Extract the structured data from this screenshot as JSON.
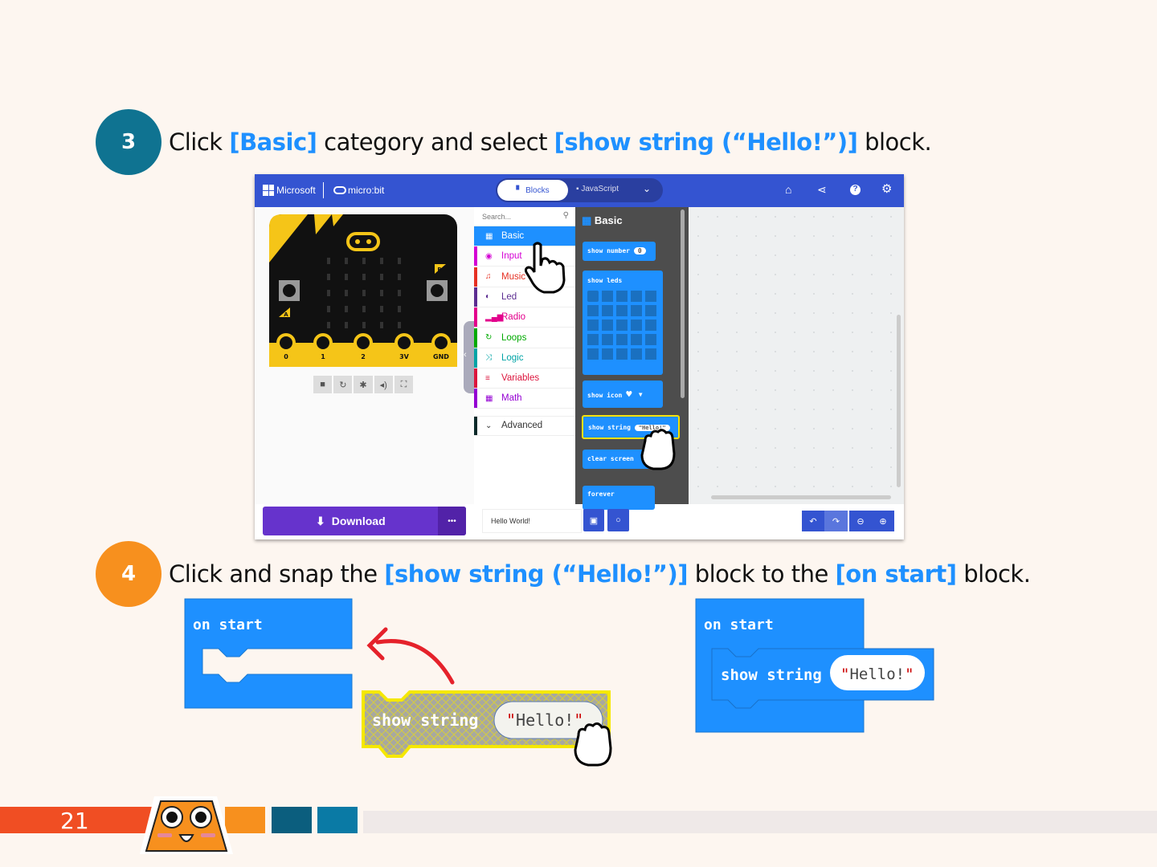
{
  "step3": {
    "number": "3",
    "text_parts": [
      "Click ",
      "[Basic]",
      " category and select ",
      "[show string (“Hello!”)]",
      " block."
    ]
  },
  "editor": {
    "brand": "Microsoft",
    "product": "micro:bit",
    "tabs": [
      {
        "label": "Blocks",
        "active": true
      },
      {
        "label": "JavaScript",
        "active": false
      }
    ],
    "header_icons": [
      "home-icon",
      "share-icon",
      "help-icon",
      "settings-icon"
    ],
    "simulator": {
      "pins": [
        "0",
        "1",
        "2",
        "3V",
        "GND"
      ],
      "buttons": [
        "A",
        "B"
      ],
      "controls": [
        "stop-icon",
        "restart-icon",
        "debug-icon",
        "mute-icon",
        "fullscreen-icon"
      ]
    },
    "search_placeholder": "Search...",
    "categories": [
      {
        "label": "Basic",
        "icon": "grid-icon",
        "color": "#1e90ff",
        "selected": true
      },
      {
        "label": "Input",
        "icon": "target-icon",
        "color": "#d400d4"
      },
      {
        "label": "Music",
        "icon": "headphones-icon",
        "color": "#e63022"
      },
      {
        "label": "Led",
        "icon": "toggle-icon",
        "color": "#5c2d91"
      },
      {
        "label": "Radio",
        "icon": "signal-icon",
        "color": "#e3008c"
      },
      {
        "label": "Loops",
        "icon": "loop-icon",
        "color": "#00aa00"
      },
      {
        "label": "Logic",
        "icon": "shuffle-icon",
        "color": "#00a4a6"
      },
      {
        "label": "Variables",
        "icon": "list-icon",
        "color": "#dc143c"
      },
      {
        "label": "Math",
        "icon": "calculator-icon",
        "color": "#9400d3"
      },
      {
        "label": "Advanced",
        "icon": "chevron-down-icon",
        "color": "#0a2a2a"
      }
    ],
    "flyout": {
      "title": "Basic",
      "blocks": {
        "show_number": "show number",
        "show_number_value": "0",
        "show_leds": "show leds",
        "show_icon": "show icon",
        "show_string": "show string",
        "show_string_value": "\"Hello!\"",
        "clear_screen": "clear screen",
        "forever": "forever"
      }
    },
    "download_label": "Download",
    "more_label": "•••",
    "project_name": "Hello World!"
  },
  "step4": {
    "number": "4",
    "text_parts": [
      "Click and snap the ",
      "[show string (“Hello!”)]",
      " block to the ",
      "[on start]",
      " block."
    ],
    "on_start": "on start",
    "show_string": "show string",
    "value": "Hello!"
  },
  "footer": {
    "page_number": "21"
  },
  "colors": {
    "accent": "#1e90ff",
    "step3": "#0f7391",
    "step4": "#f7901e",
    "header": "#3454d1",
    "download": "#6633cc",
    "footer_red": "#f04e23"
  }
}
